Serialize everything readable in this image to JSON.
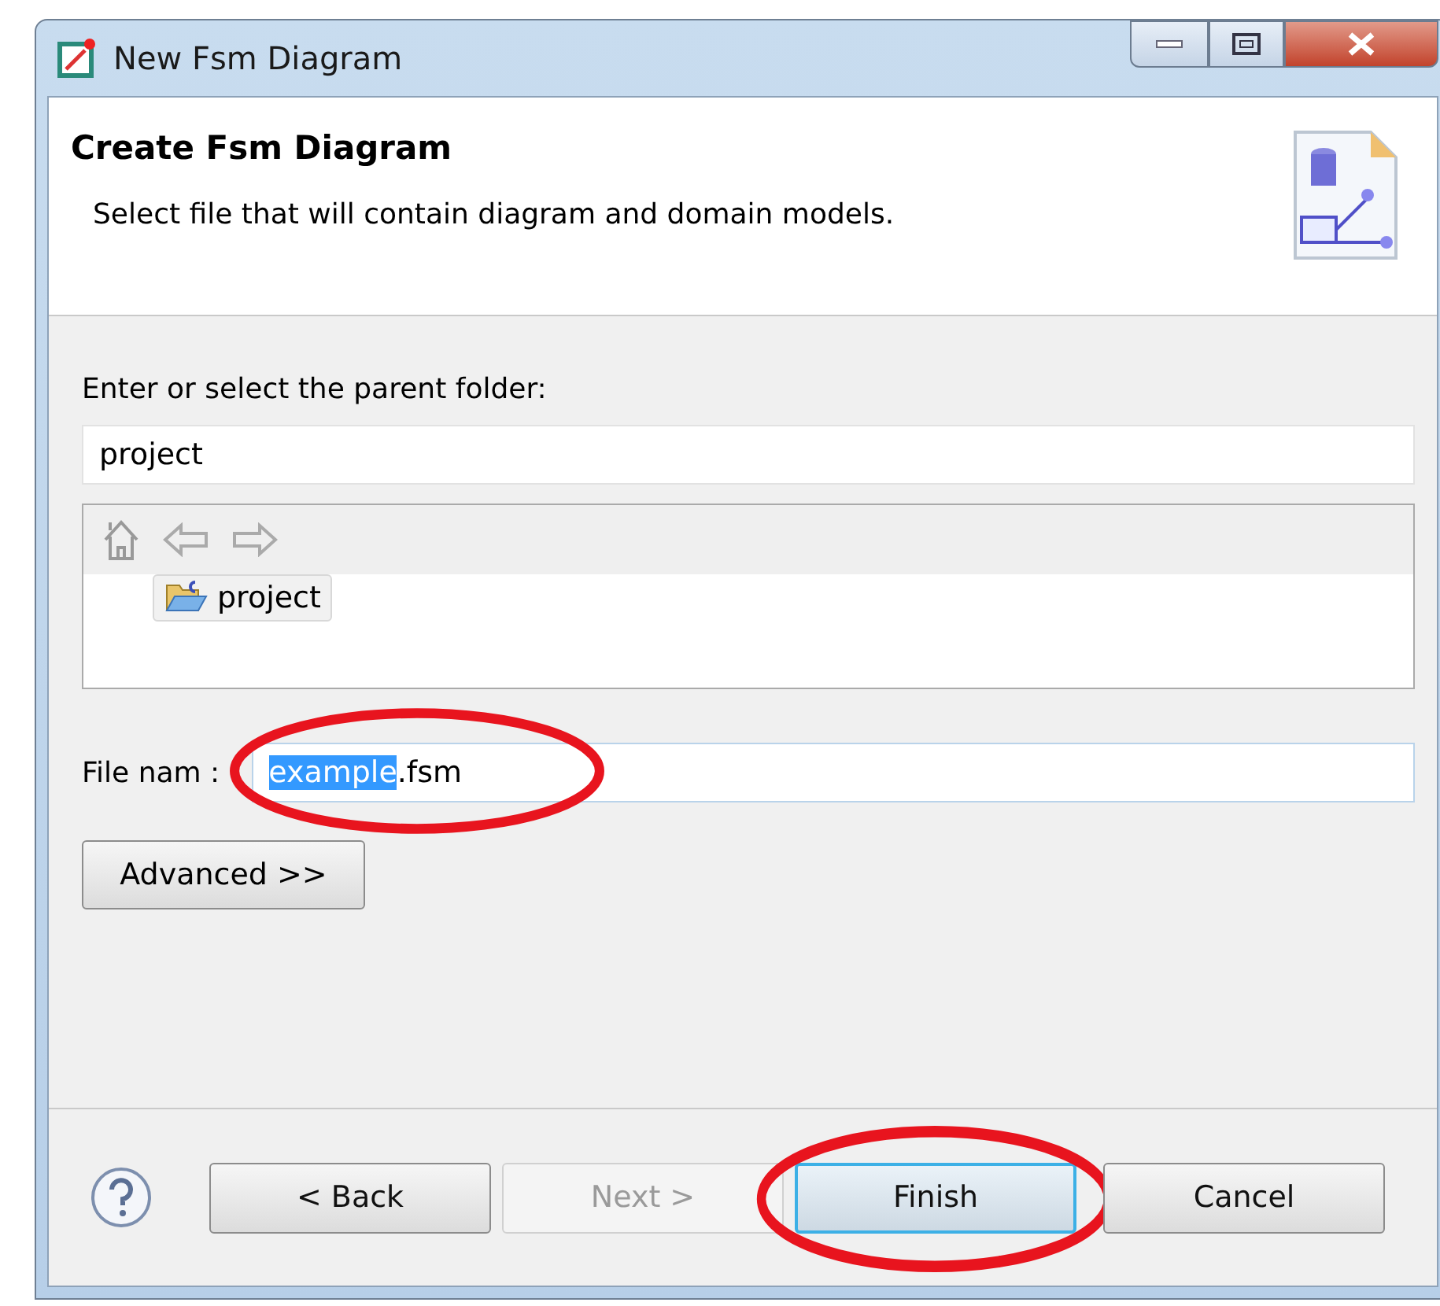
{
  "window": {
    "title": "New Fsm Diagram"
  },
  "header": {
    "title": "Create Fsm Diagram",
    "description": "Select file that will contain diagram and domain models."
  },
  "parent_folder": {
    "label": "Enter or select the parent folder:",
    "value": "project"
  },
  "folder_tree": {
    "items": [
      {
        "label": "project",
        "selected": true
      }
    ]
  },
  "file_name": {
    "label": "File nam :",
    "value": [
      {
        "text": "example",
        "selected": true
      },
      {
        "text": ".fsm",
        "selected": false
      }
    ],
    "annotated": true
  },
  "advanced_button": "Advanced >>",
  "buttons": [
    {
      "label": "< Back",
      "disabled": false,
      "focused": false,
      "annotated": false
    },
    {
      "label": "Next >",
      "disabled": true,
      "focused": false,
      "annotated": false
    },
    {
      "label": "Finish",
      "disabled": false,
      "focused": true,
      "annotated": true
    },
    {
      "label": "Cancel",
      "disabled": false,
      "focused": false,
      "annotated": false
    }
  ]
}
